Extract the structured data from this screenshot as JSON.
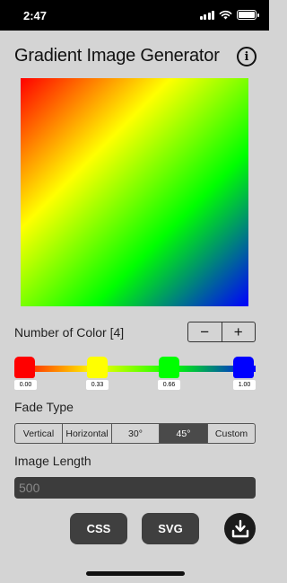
{
  "status_bar": {
    "time": "2:47",
    "icons": [
      "signal-icon",
      "wifi-icon",
      "battery-icon"
    ]
  },
  "header": {
    "title": "Gradient Image Generator",
    "info_icon": "info-icon"
  },
  "preview": {
    "colors": [
      "#ff0000",
      "#ffff00",
      "#00ff00",
      "#0000ff"
    ],
    "angle": "45°"
  },
  "colors_section": {
    "label": "Number of Color [4]",
    "minus": "−",
    "plus": "+",
    "stops": [
      {
        "color": "#ff0000",
        "label": "0.00",
        "position": 0.0
      },
      {
        "color": "#ffff00",
        "label": "0.33",
        "position": 0.33
      },
      {
        "color": "#00ff00",
        "label": "0.66",
        "position": 0.66
      },
      {
        "color": "#0000ff",
        "label": "1.00",
        "position": 1.0
      }
    ]
  },
  "fade": {
    "label": "Fade Type",
    "options": [
      "Vertical",
      "Horizontal",
      "30°",
      "45°",
      "Custom"
    ],
    "selected": "45°"
  },
  "image_length": {
    "label": "Image Length",
    "placeholder": "500"
  },
  "actions": {
    "css_label": "CSS",
    "svg_label": "SVG",
    "download_icon": "download-icon"
  }
}
